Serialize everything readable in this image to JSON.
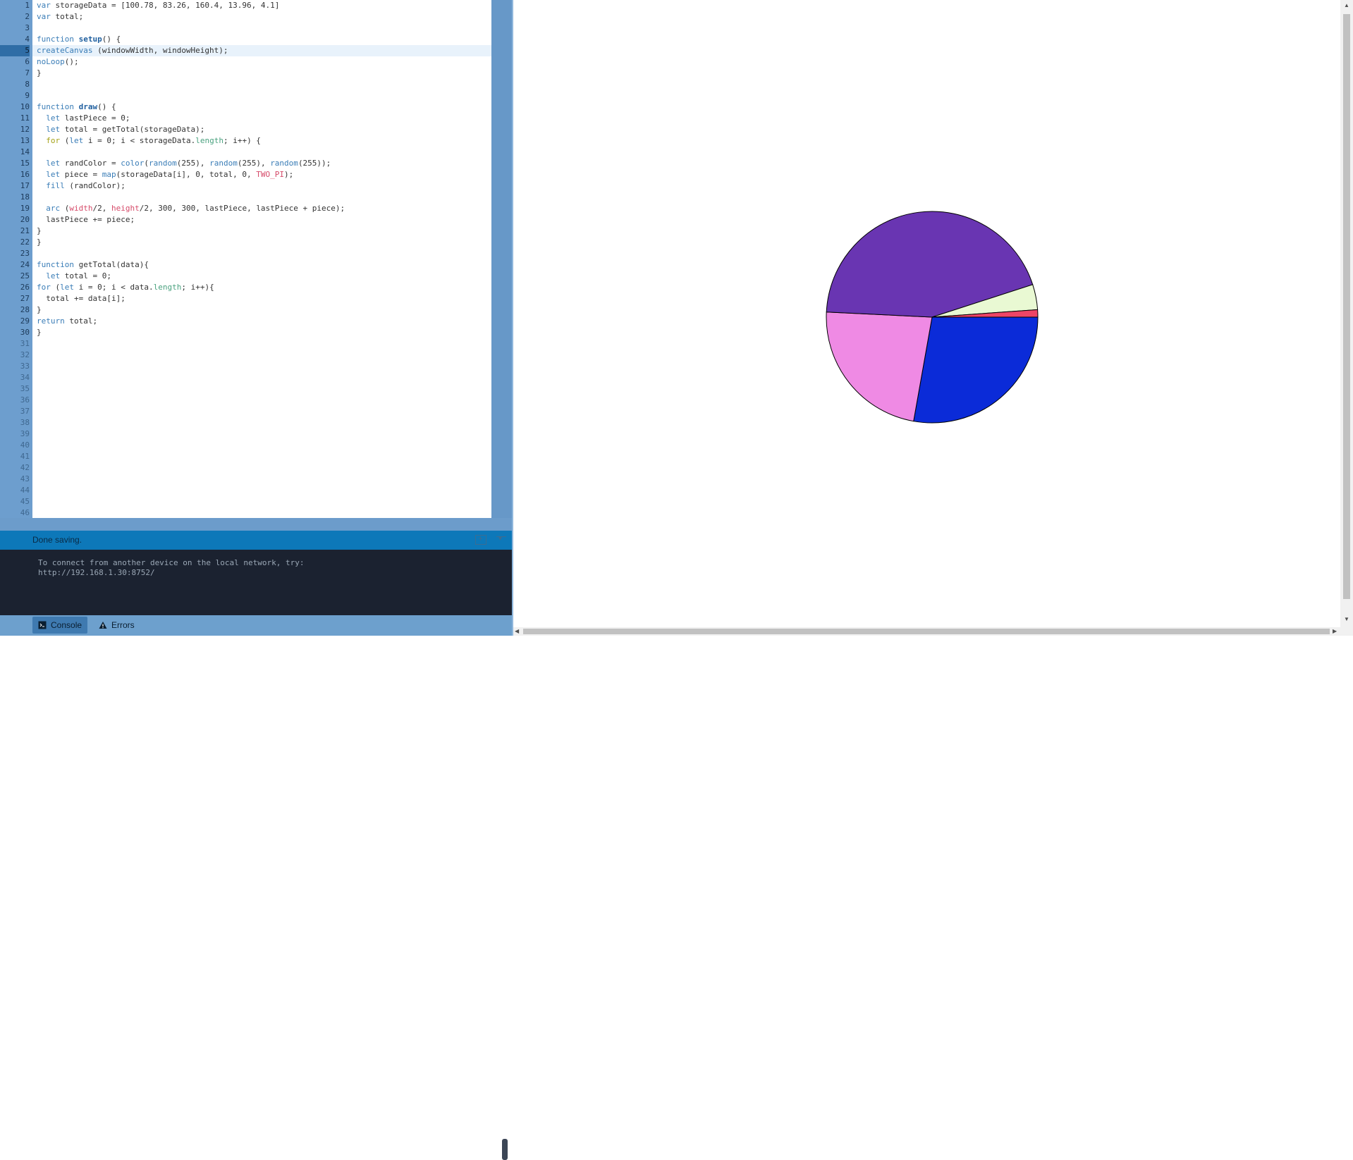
{
  "editor": {
    "lines": [
      [
        "var storageData = [100.78, 83.26, 160.4, 13.96, 4.1]"
      ],
      [
        "var total;"
      ],
      [
        ""
      ],
      [
        "function setup() {"
      ],
      [
        "createCanvas (windowWidth, windowHeight);"
      ],
      [
        "noLoop();"
      ],
      [
        "}"
      ],
      [
        ""
      ],
      [
        ""
      ],
      [
        "function draw() {"
      ],
      [
        "  let lastPiece = 0;"
      ],
      [
        "  let total = getTotal(storageData);"
      ],
      [
        "  for (let i = 0; i < storageData.length; i++) {"
      ],
      [
        ""
      ],
      [
        "  let randColor = color(random(255), random(255), random(255));"
      ],
      [
        "  let piece = map(storageData[i], 0, total, 0, TWO_PI);"
      ],
      [
        "  fill (randColor);"
      ],
      [
        ""
      ],
      [
        "  arc (width/2, height/2, 300, 300, lastPiece, lastPiece + piece);"
      ],
      [
        "  lastPiece += piece;"
      ],
      [
        "}"
      ],
      [
        "}"
      ],
      [
        ""
      ],
      [
        "function getTotal(data){"
      ],
      [
        "  let total = 0;"
      ],
      [
        "for (let i = 0; i < data.length; i++){"
      ],
      [
        "  total += data[i];"
      ],
      [
        "}"
      ],
      [
        "return total;"
      ],
      [
        "}"
      ]
    ],
    "line_count": 46,
    "active_line": 5
  },
  "console": {
    "status": "Done saving.",
    "output": [
      "To connect from another device on the local network, try:",
      "http://192.168.1.30:8752/"
    ],
    "tabs": {
      "console_label": "Console",
      "errors_label": "Errors"
    }
  },
  "preview": {
    "chart_data": {
      "type": "pie",
      "values": [
        100.78,
        83.26,
        160.4,
        13.96,
        4.1
      ],
      "colors": [
        "#0b2bd8",
        "#ef8ae4",
        "#6935b2",
        "#e9f9d3",
        "#ee4566"
      ],
      "start_angle": "0 (east), clockwise",
      "stroke": "#000000"
    }
  }
}
